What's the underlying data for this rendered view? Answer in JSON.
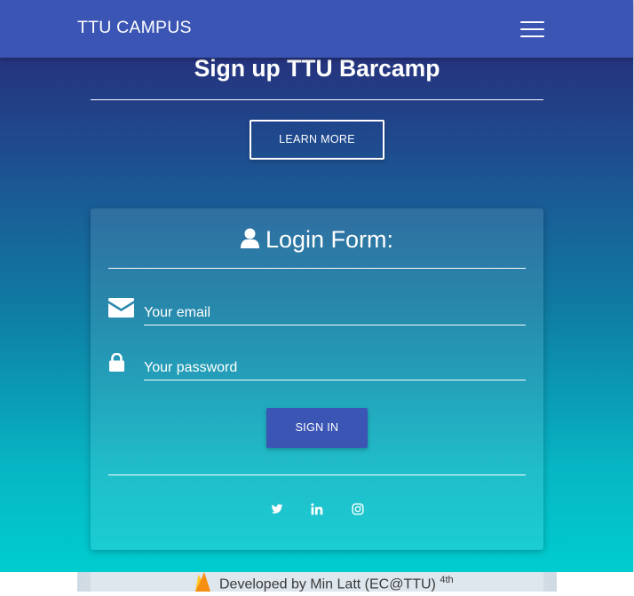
{
  "navbar": {
    "brand": "TTU CAMPUS",
    "menu_icon": "hamburger-menu-icon"
  },
  "hero": {
    "title": "Sign up TTU Barcamp",
    "learn_more_label": "LEARN MORE"
  },
  "login_form": {
    "title": "Login Form:",
    "title_icon": "user-icon",
    "email": {
      "icon": "envelope-icon",
      "placeholder": "Your email",
      "value": ""
    },
    "password": {
      "icon": "lock-icon",
      "placeholder": "Your password",
      "value": ""
    },
    "sign_in_label": "SIGN IN",
    "social": [
      "twitter-icon",
      "linkedin-icon",
      "instagram-icon"
    ]
  },
  "footer": {
    "icon": "flame-icon",
    "text": "Developed by Min Latt (EC@TTU) ",
    "superscript": "4th"
  },
  "colors": {
    "navbar": "#3b55b4",
    "button": "#3b55b4",
    "gradient_top": "#2a2472",
    "gradient_bottom": "#00cdd0",
    "text": "#ffffff"
  }
}
